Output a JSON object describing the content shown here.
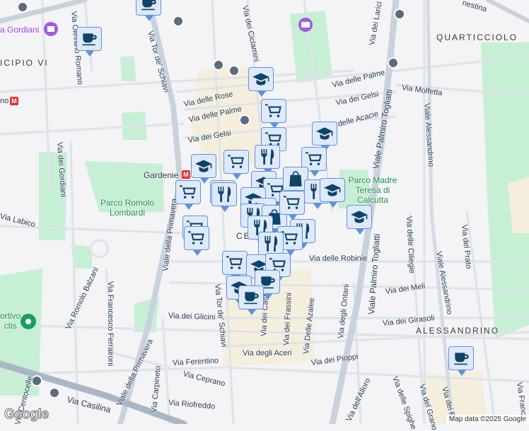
{
  "map": {
    "areas": {
      "municipio": "ICIPIO VI",
      "quarticciolo": "QUARTICCIOLO",
      "alessandrino": "ALESSANDRINO",
      "centocelle_partial": "CE"
    },
    "parks": {
      "romolo_lombardi": "Parco Romolo Lombardi",
      "madre_teresa": "Parco Madre Teresa di Calcutta",
      "sportivo_partial": "ortivo\nctis"
    },
    "pois": {
      "villa_gordiani": "a Gordiani"
    },
    "stations": {
      "gardenie": "Gardenie",
      "partial_west": "no"
    },
    "streets": {
      "olevano": "Via Olevano Romano",
      "tor_schiavi": "Via Tor de' Schiavi",
      "tor_schiavi_2": "Via Tor de' Schiavi",
      "ciclamini": "Via dei Ciclamini",
      "rose": "Via delle Rose",
      "palme": "Via delle Palme",
      "gelsi": "Via dei Gelsi",
      "gordiani": "Via dei Gordiani",
      "labico": "Via Labico",
      "primavera": "Viale della Primavera",
      "primavera_2": "Viale della Primavera",
      "balzani": "Via Romolo Balzani",
      "ferraironi": "Via Francesco Ferraironi",
      "glicini": "Via dei Glicini",
      "ferentino": "Via Ferentino",
      "ceprano": "Via Ceprano",
      "riofreddo": "Via Riofreddo",
      "carpineto": "Via Carpineto",
      "casilina": "Via Casilina",
      "centocelle": "Via Centocelle",
      "larici": "Via dei Larici",
      "palme_2": "Via delle Palme",
      "gelsi_2": "Via dei Gelsi",
      "molfetta": "Via Molfetta",
      "acacie": "Via delle Acacie",
      "togliatti": "Viale Palmiro Togliatti",
      "togliatti_2": "Viale Palmiro Togliatti",
      "alessandrino": "Viale Alessandrino",
      "alessandrino_2": "Viale Alessandrino",
      "robinie": "Via delle Robinie",
      "ciliegie": "Via delle Ciliegie",
      "prato": "Via del Prato",
      "meli": "Via dei Meli",
      "girasoli": "Via dei Girasoli",
      "ontani": "Via degli Ontani",
      "azalee": "Via Delle Azalee",
      "frassini": "Via dei Frassini",
      "castani": "Via dei Castani",
      "aceri": "Via degli Aceri",
      "pioppi": "Via dei Pioppi",
      "alloro": "Via dell'Alloro",
      "spighe": "Via delle Spighe",
      "grano": "Via del Grano",
      "fiori": "Via dei Fi",
      "franc": "Via Franc",
      "prenestina": "nestina"
    },
    "marker_types": [
      "coffee",
      "cart",
      "school",
      "utensils",
      "shopping-bag"
    ],
    "logo": "Google",
    "attribution": "Map data ©2025 Google"
  }
}
